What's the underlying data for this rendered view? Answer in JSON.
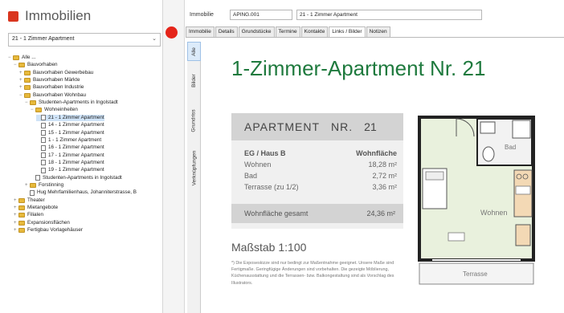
{
  "left": {
    "title": "Immobilien",
    "select_value": "21 - 1 Zimmer Apartment",
    "tree": [
      {
        "level": 0,
        "kind": "folder",
        "exp": "−",
        "label": "Alle ..."
      },
      {
        "level": 1,
        "kind": "folder",
        "exp": "−",
        "label": "Bauvorhaben"
      },
      {
        "level": 2,
        "kind": "folder",
        "exp": "+",
        "label": "Bauvorhaben Gewerbebau"
      },
      {
        "level": 2,
        "kind": "folder",
        "exp": "+",
        "label": "Bauvorhaben Märkte"
      },
      {
        "level": 2,
        "kind": "folder",
        "exp": "+",
        "label": "Bauvorhaben Industrie"
      },
      {
        "level": 2,
        "kind": "folder",
        "exp": "−",
        "label": "Bauvorhaben Wohnbau"
      },
      {
        "level": 3,
        "kind": "folder",
        "exp": "−",
        "label": "Studenten-Apartments in Ingolstadt"
      },
      {
        "level": 4,
        "kind": "folder",
        "exp": "−",
        "label": "Wohneinheiten"
      },
      {
        "level": 5,
        "kind": "doc",
        "exp": "",
        "label": "21 - 1 Zimmer Apartment",
        "selected": true
      },
      {
        "level": 5,
        "kind": "doc",
        "exp": "",
        "label": "14 - 1 Zimmer Apartment"
      },
      {
        "level": 5,
        "kind": "doc",
        "exp": "",
        "label": "15 - 1 Zimmer Apartment"
      },
      {
        "level": 5,
        "kind": "doc",
        "exp": "",
        "label": "1 - 1 Zimmer Apartment"
      },
      {
        "level": 5,
        "kind": "doc",
        "exp": "",
        "label": "16 - 1 Zimmer Apartment"
      },
      {
        "level": 5,
        "kind": "doc",
        "exp": "",
        "label": "17 - 1 Zimmer Apartment"
      },
      {
        "level": 5,
        "kind": "doc",
        "exp": "",
        "label": "18 - 1 Zimmer Apartment"
      },
      {
        "level": 5,
        "kind": "doc",
        "exp": "",
        "label": "19 - 1 Zimmer Apartment"
      },
      {
        "level": 4,
        "kind": "doc",
        "exp": "",
        "label": "Studenten-Apartments in Ingolstadt"
      },
      {
        "level": 3,
        "kind": "folder",
        "exp": "+",
        "label": "Forstinning"
      },
      {
        "level": 3,
        "kind": "doc",
        "exp": "",
        "label": "Hug Mehrfamilienhaus, Johanniterstrasse, B"
      },
      {
        "level": 1,
        "kind": "folder",
        "exp": "+",
        "label": "Theater"
      },
      {
        "level": 1,
        "kind": "folder",
        "exp": "+",
        "label": "Mietangebote"
      },
      {
        "level": 1,
        "kind": "folder",
        "exp": "+",
        "label": "Filialen"
      },
      {
        "level": 1,
        "kind": "folder",
        "exp": "+",
        "label": "Expansionsflächen"
      },
      {
        "level": 1,
        "kind": "folder",
        "exp": "+",
        "label": "Fertigbau Vorlagehäuser"
      }
    ]
  },
  "header": {
    "label": "Immobilie",
    "id_value": "APING.001",
    "name_value": "21 - 1 Zimmer Apartment"
  },
  "tabs": [
    "Immobilie",
    "Details",
    "Grundstücke",
    "Termine",
    "Kontakte",
    "Links / Bilder",
    "Notizen"
  ],
  "active_tab": "Links / Bilder",
  "vtabs": [
    "Alle",
    "Bilder",
    "Grundriss",
    "Verknüpfungen"
  ],
  "active_vtab": "Alle",
  "doc": {
    "title": "1-Zimmer-Apartment Nr. 21",
    "card_apartment": "APARTMENT",
    "card_nr": "NR.",
    "card_num": "21",
    "floor": "EG / Haus B",
    "area_header": "Wohnfläche",
    "rows": [
      {
        "label": "Wohnen",
        "value": "18,28 m²"
      },
      {
        "label": "Bad",
        "value": "2,72 m²"
      },
      {
        "label": "Terrasse (zu 1/2)",
        "value": "3,36 m²"
      }
    ],
    "total_label": "Wohnfläche gesamt",
    "total_value": "24,36 m²",
    "scale": "Maßstab 1:100",
    "note": "*) Die Exposeskizze sind nur bedingt zur Maßentnahme geeignet. Unsere Maße sind Fertigmaße. Geringfügige Änderungen sind vorbehalten. Die gezeigte Möblierung, Küchenausstattung und die Terrassen- bzw. Balkongestaltung sind als Vorschlag des Illustrators.",
    "plan_labels": {
      "bath": "Bad",
      "living": "Wohnen",
      "terrace": "Terrasse"
    }
  }
}
